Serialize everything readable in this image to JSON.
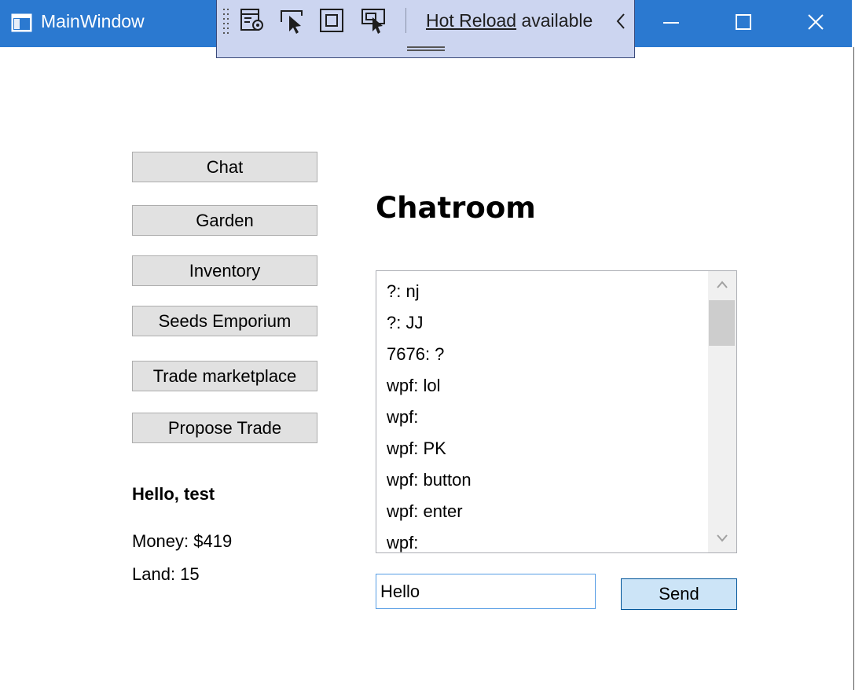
{
  "window": {
    "title": "MainWindow"
  },
  "hot_reload": {
    "link": "Hot Reload",
    "suffix": " available"
  },
  "nav": [
    {
      "label": "Chat"
    },
    {
      "label": "Garden"
    },
    {
      "label": "Inventory"
    },
    {
      "label": "Seeds Emporium"
    },
    {
      "label": "Trade marketplace"
    },
    {
      "label": "Propose Trade"
    }
  ],
  "user": {
    "greeting": "Hello, test",
    "money": "Money: $419",
    "land": "Land: 15"
  },
  "chat": {
    "heading": "Chatroom",
    "messages": [
      "?: nj",
      "?: JJ",
      "7676: ?",
      "wpf: lol",
      "wpf:",
      "wpf: PK",
      "wpf: button",
      "wpf: enter",
      "wpf:"
    ],
    "input_value": "Hello",
    "send_label": "Send"
  },
  "colors": {
    "titlebar": "#2b79d0",
    "toolbar": "#ccd5f0",
    "send_button": "#cce4f7"
  }
}
